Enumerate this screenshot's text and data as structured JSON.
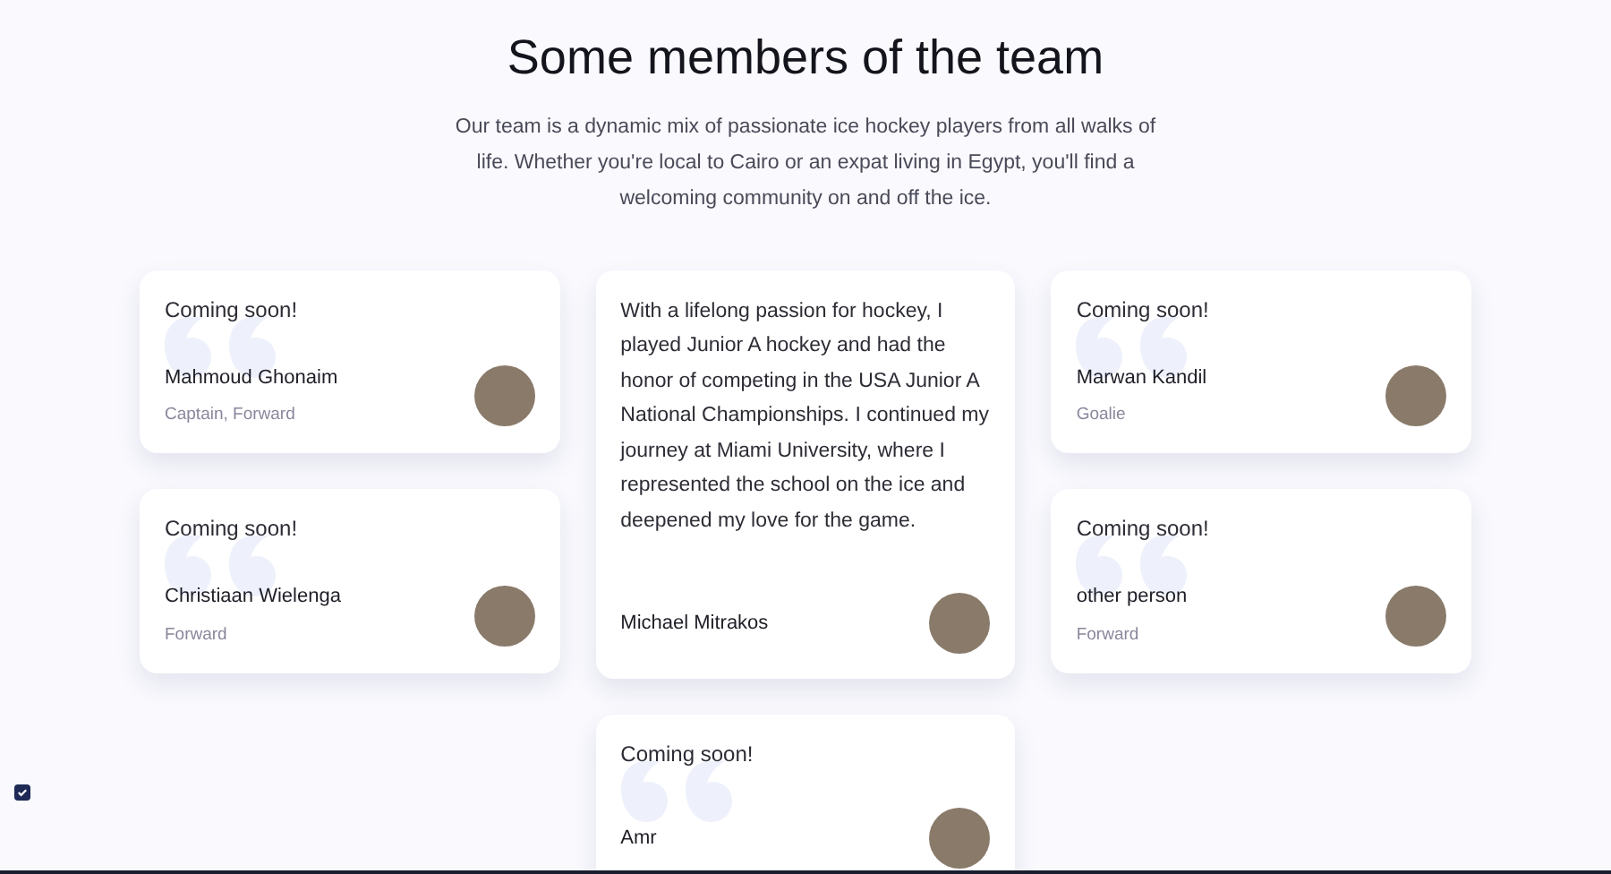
{
  "heading": "Some members of the team",
  "intro": "Our team is a dynamic mix of passionate ice hockey players from all walks of life. Whether you're local to Cairo or an expat living in Egypt, you'll find a welcoming community on and off the ice.",
  "columns": [
    [
      {
        "quote": "Coming soon!",
        "name": "Mahmoud Ghonaim",
        "role": "Captain, Forward"
      },
      {
        "quote": "Coming soon!",
        "name": "Christiaan Wielenga",
        "role": "Forward"
      }
    ],
    [
      {
        "quote": "With a lifelong passion for hockey, I played Junior A hockey and had the honor of competing in the USA Junior A National Championships. I continued my journey at Miami University, where I represented the school on the ice and deepened my love for the game.",
        "name": "Michael Mitrakos"
      },
      {
        "quote": "Coming soon!",
        "name": "Amr"
      }
    ],
    [
      {
        "quote": "Coming soon!",
        "name": "Marwan Kandil",
        "role": "Goalie"
      },
      {
        "quote": "Coming soon!",
        "name": "other person",
        "role": "Forward"
      }
    ]
  ]
}
